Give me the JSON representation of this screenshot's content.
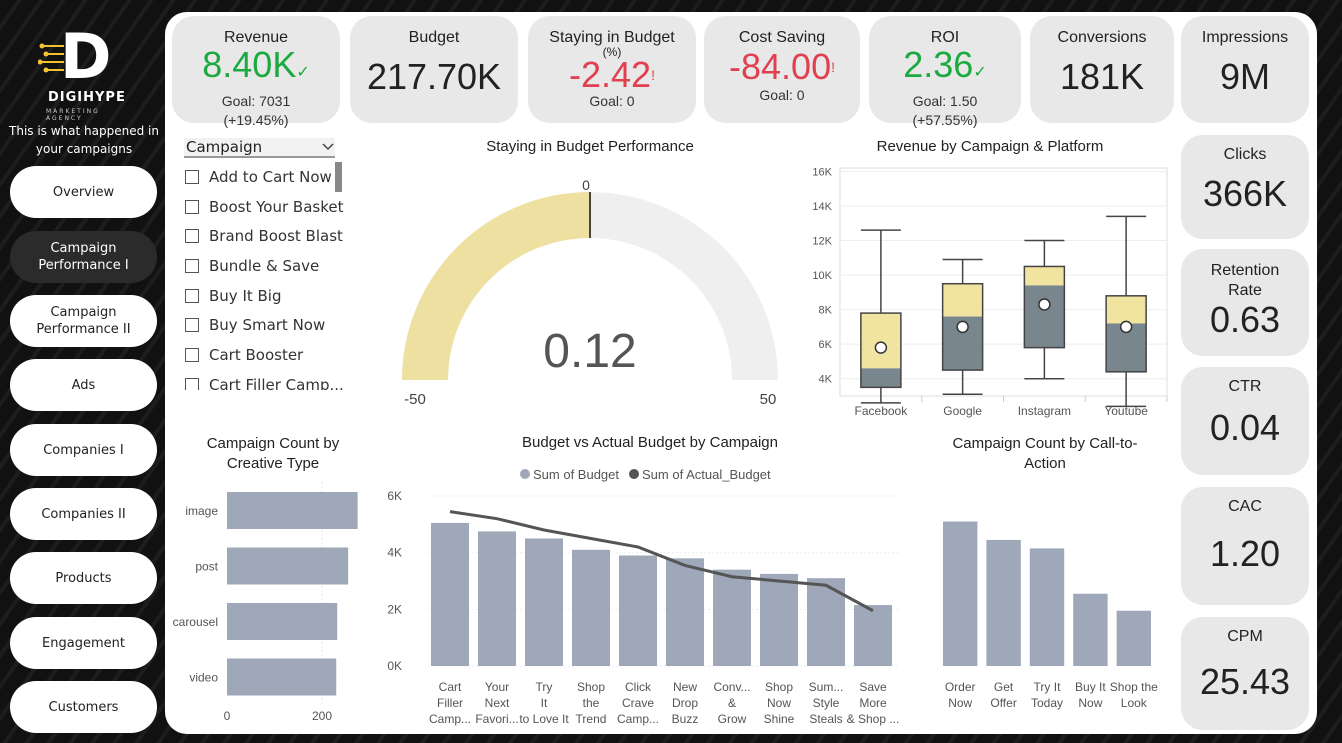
{
  "brand": {
    "name": "DIGIHYPE",
    "sub": "MARKETING AGENCY",
    "letter": "D"
  },
  "tagline": "This is what happened in your campaigns",
  "nav": [
    {
      "label": "Overview",
      "active": false
    },
    {
      "label": "Campaign Performance I",
      "active": true
    },
    {
      "label": "Campaign Performance II",
      "active": false
    },
    {
      "label": "Ads",
      "active": false
    },
    {
      "label": "Companies I",
      "active": false
    },
    {
      "label": "Companies II",
      "active": false
    },
    {
      "label": "Products",
      "active": false
    },
    {
      "label": "Engagement",
      "active": false
    },
    {
      "label": "Customers",
      "active": false
    }
  ],
  "kpis": {
    "revenue": {
      "title": "Revenue",
      "value": "8.40K",
      "mark": "✓",
      "goal": "Goal: 7031",
      "delta": "(+19.45%)"
    },
    "budget": {
      "title": "Budget",
      "value": "217.70K"
    },
    "staying": {
      "title": "Staying in Budget",
      "title2": "(%)",
      "value": "-2.42",
      "mark": "!",
      "goal": "Goal: 0"
    },
    "cost_saving": {
      "title": "Cost Saving",
      "value": "-84.00",
      "mark": "!",
      "goal": "Goal: 0"
    },
    "roi": {
      "title": "ROI",
      "value": "2.36",
      "mark": "✓",
      "goal": "Goal: 1.50",
      "delta": "(+57.55%)"
    },
    "conversions": {
      "title": "Conversions",
      "value": "181K"
    },
    "impressions": {
      "title": "Impressions",
      "value": "9M"
    },
    "clicks": {
      "title": "Clicks",
      "value": "366K"
    },
    "retention": {
      "title": "Retention Rate",
      "value": "0.63"
    },
    "ctr": {
      "title": "CTR",
      "value": "0.04"
    },
    "cac": {
      "title": "CAC",
      "value": "1.20"
    },
    "cpm": {
      "title": "CPM",
      "value": "25.43"
    }
  },
  "colors": {
    "accent_green": "#1aaa3f",
    "accent_red": "#e04050",
    "gauge_fill": "#ede0a0",
    "bar": "#9ea8b8",
    "box_dark": "#7a868e",
    "box_light": "#f1e4a0"
  },
  "slicer": {
    "title": "Campaign",
    "items": [
      "Add to Cart Now",
      "Boost Your Basket",
      "Brand Boost Blast",
      "Bundle & Save",
      "Buy It Big",
      "Buy Smart Now",
      "Cart Booster",
      "Cart Filler Camp..."
    ]
  },
  "gauge": {
    "title": "Staying in Budget Performance",
    "value_label": "0.12",
    "value": 0.12,
    "min": -50,
    "max": 50,
    "target": 0,
    "min_label": "-50",
    "max_label": "50",
    "target_label": "0"
  },
  "chart_data": [
    {
      "type": "box",
      "title": "Revenue by Campaign & Platform",
      "categories": [
        "Facebook",
        "Google",
        "Instagram",
        "Youtube"
      ],
      "y_ticks": [
        "4K",
        "6K",
        "8K",
        "10K",
        "12K",
        "14K",
        "16K"
      ],
      "ylim": [
        3000,
        16200
      ],
      "series": [
        {
          "min": 2600,
          "q1": 3500,
          "median": 4600,
          "q3": 7800,
          "max": 12600,
          "mean": 5800
        },
        {
          "min": 3100,
          "q1": 4500,
          "median": 7600,
          "q3": 9500,
          "max": 10900,
          "mean": 7000
        },
        {
          "min": 4000,
          "q1": 5800,
          "median": 9400,
          "q3": 10500,
          "max": 12000,
          "mean": 8300
        },
        {
          "min": 2400,
          "q1": 4400,
          "median": 7200,
          "q3": 8800,
          "max": 13400,
          "mean": 7000
        }
      ]
    },
    {
      "type": "bar",
      "orientation": "horizontal",
      "title": "Campaign Count by Creative Type",
      "categories": [
        "image",
        "post",
        "carousel",
        "video"
      ],
      "values": [
        275,
        255,
        232,
        230
      ],
      "x_ticks": [
        "0",
        "200"
      ],
      "xlim": [
        0,
        280
      ]
    },
    {
      "type": "bar",
      "title": "Budget vs Actual Budget by Campaign",
      "legend": [
        "Sum of Budget",
        "Sum of Actual_Budget"
      ],
      "categories": [
        "Cart Filler Camp...",
        "Your Next Favori...",
        "Try It to Love It",
        "Shop the Trend",
        "Click Crave Camp...",
        "New Drop Buzz",
        "Conv... & Grow",
        "Shop Now Shine",
        "Sum... Style Steals",
        "Save More & Shop ..."
      ],
      "series": [
        {
          "name": "Sum of Budget",
          "values": [
            5050,
            4750,
            4500,
            4100,
            3900,
            3800,
            3400,
            3250,
            3100,
            2150
          ]
        },
        {
          "name": "Sum of Actual_Budget",
          "values": [
            5450,
            5200,
            4800,
            4500,
            4200,
            3550,
            3150,
            3000,
            2850,
            1950
          ]
        }
      ],
      "y_ticks": [
        "0K",
        "2K",
        "4K",
        "6K"
      ],
      "ylim": [
        0,
        6000
      ]
    },
    {
      "type": "bar",
      "title": "Campaign Count by Call-to-Action",
      "categories": [
        "Order Now",
        "Get Offer",
        "Try It Today",
        "Buy It Now",
        "Shop the Look"
      ],
      "values": [
        5100,
        4450,
        4150,
        2550,
        1950
      ],
      "ylim": [
        0,
        6000
      ]
    }
  ]
}
